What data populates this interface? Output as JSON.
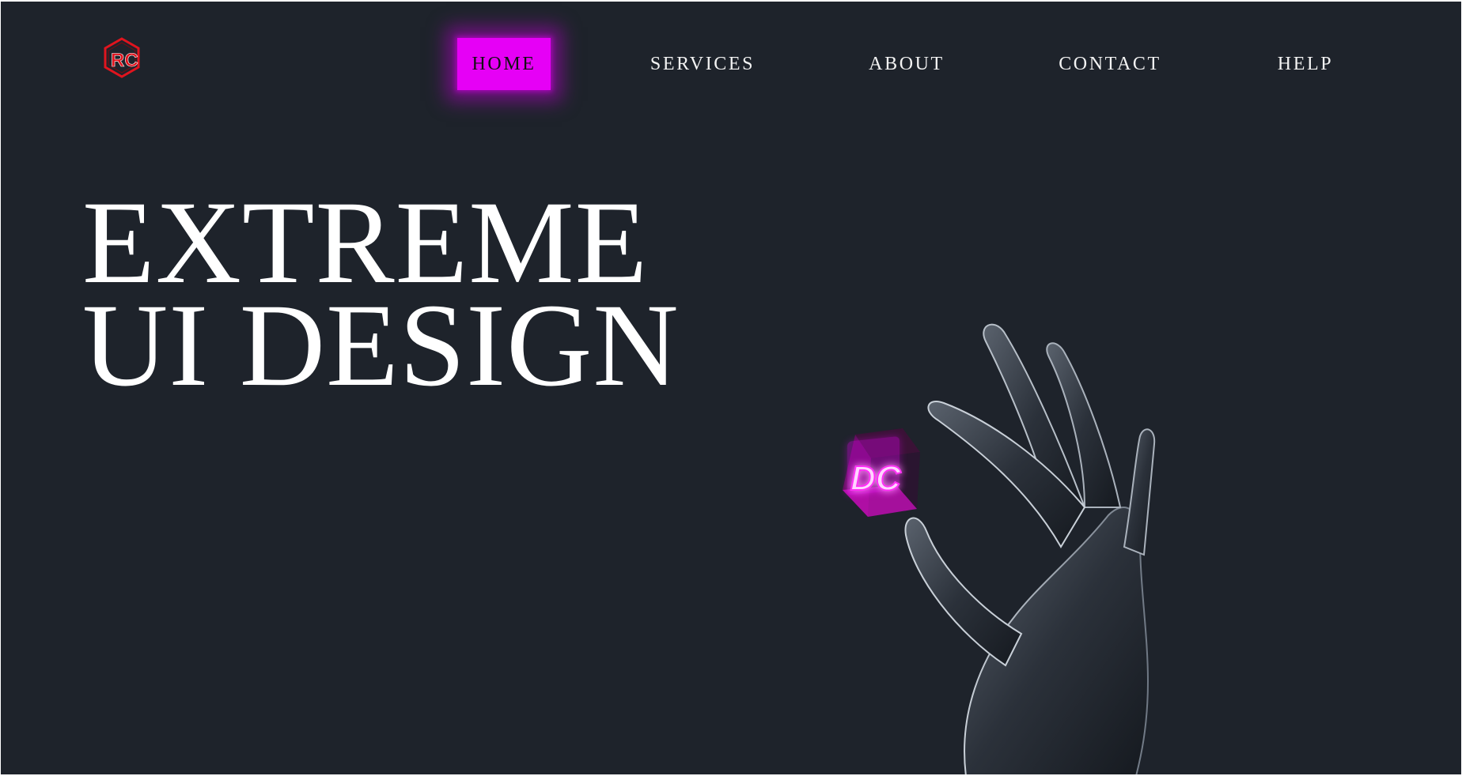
{
  "logo": {
    "text": "RC",
    "icon": "rc-hexagon-logo-icon",
    "colors": {
      "hexagon": "#e0141e",
      "letter_r": "#e0141e",
      "letter_c": "#ffffff"
    }
  },
  "nav": {
    "items": [
      {
        "label": "HOME",
        "active": true
      },
      {
        "label": "SERVICES",
        "active": false
      },
      {
        "label": "ABOUT",
        "active": false
      },
      {
        "label": "CONTACT",
        "active": false
      },
      {
        "label": "HELP",
        "active": false
      }
    ]
  },
  "hero": {
    "line1": "EXTREME",
    "line2": "UI DESIGN"
  },
  "illustration": {
    "icon": "hand-holding-cube-icon",
    "cube_text": "DC"
  },
  "colors": {
    "background": "#1e232b",
    "accent": "#e600f6",
    "text": "#ffffff"
  }
}
